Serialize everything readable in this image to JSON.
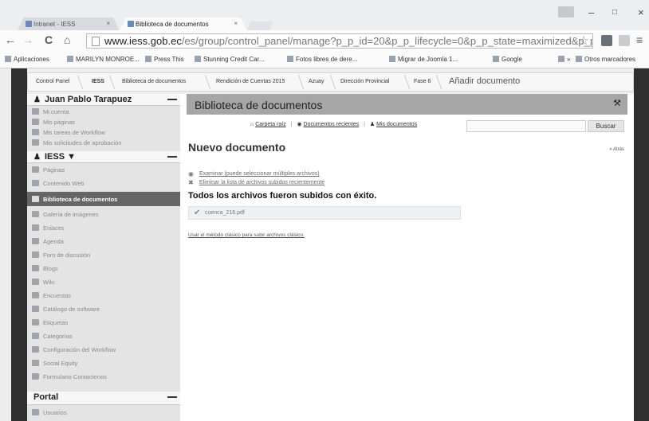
{
  "browser": {
    "tabs": [
      {
        "label": "Intranet - IESS",
        "close": "×"
      },
      {
        "label": "Biblioteca de documentos",
        "close": "×"
      }
    ],
    "url_host": "www.iess.gob.ec",
    "url_path": "/es/group/control_panel/manage?p_p_id=20&p_p_lifecycle=0&p_p_state=maximized&p_p_mo",
    "window_controls": {
      "minimize": "–",
      "maximize": "□",
      "close": "×"
    },
    "nav": {
      "back": "←",
      "forward": "→",
      "reload": "C",
      "home": "⌂",
      "star": "☆",
      "menu": "≡"
    },
    "bookmarks": [
      "Aplicaciones",
      "MARILYN MONROE...",
      "Press This",
      "Stunning Credit Car...",
      "Fotos libres de dere...",
      "Migrar de Joomla 1...",
      "Google",
      "»",
      "Otros marcadores"
    ]
  },
  "breadcrumb": {
    "items": [
      "Control Panel",
      "IESS",
      "Biblioteca de documentos",
      "Rendición de Cuentas 2015",
      "Azuay",
      "Dirección Provincial",
      "Fase 6"
    ],
    "current": "Añadir documento"
  },
  "sidebar": {
    "user_section": {
      "title": "Juan Pablo Tarapuez",
      "items": [
        "Mi cuenta",
        "Mis páginas",
        "Mis tareas de Workflow",
        "Mis solicitudes de aprobación"
      ]
    },
    "site_section": {
      "title": "IESS ▼",
      "items": [
        "Páginas",
        "Contenido Web",
        "Biblioteca de documentos",
        "Galería de imágenes",
        "Enlaces",
        "Agenda",
        "Foro de discusión",
        "Blogs",
        "Wiki",
        "Encuestas",
        "Catálogo de software",
        "Etiquetas",
        "Categorías",
        "Configuración del Workflow",
        "Social Equity",
        "Formulario Contactenos"
      ],
      "active": "Biblioteca de documentos"
    },
    "portal_section": {
      "title": "Portal",
      "items": [
        "Usuarios"
      ]
    }
  },
  "portlet": {
    "title": "Biblioteca de documentos",
    "links": {
      "root_folder": "Carpeta raíz",
      "recent": "Documentos recientes",
      "mine": "Mis documentos"
    },
    "search_button": "Buscar",
    "page_title": "Nuevo documento",
    "back": "« Atrás",
    "browse_link": "Examinar (puede seleccionar múltiples archivos)",
    "clear_link": "Eliminar la lista de archivos subidos recientemente",
    "success": "Todos los archivos fueron subidos con éxito.",
    "uploaded_file": "cuenca_216.pdf",
    "classic_link": "Usar el método clásico para subir archivos clásico."
  }
}
